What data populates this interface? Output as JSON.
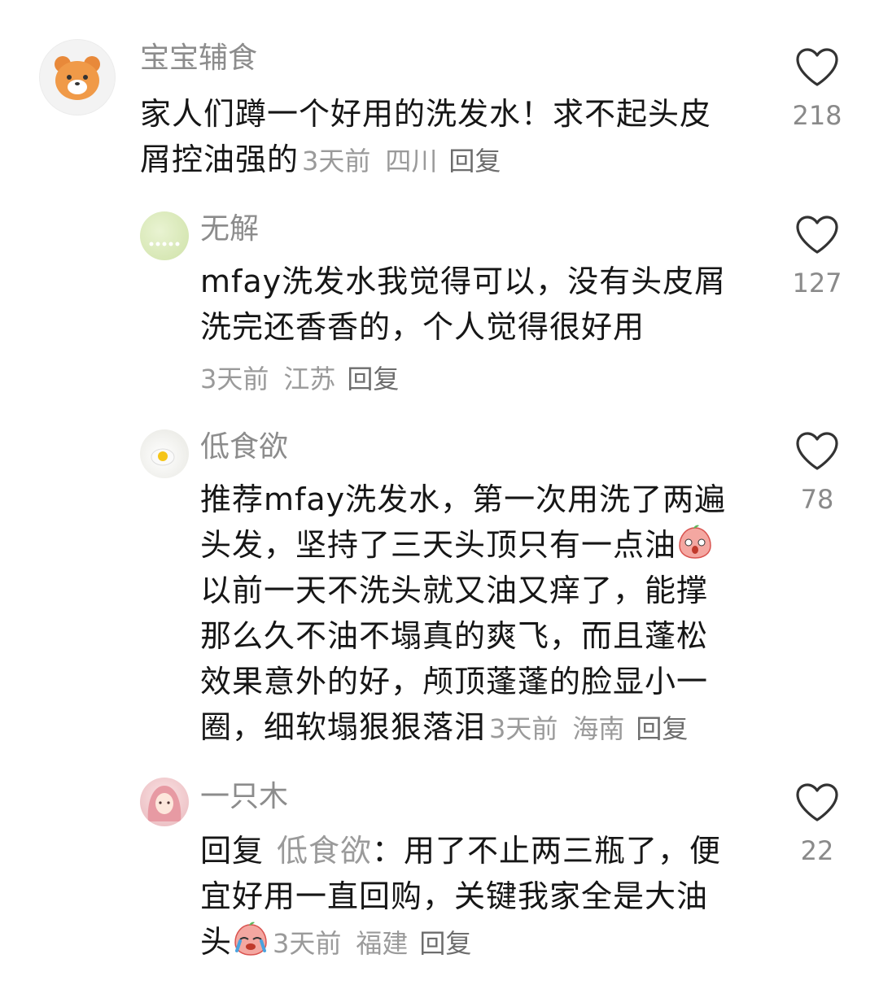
{
  "comments": [
    {
      "username": "宝宝辅食",
      "text_line1": "家人们蹲一个好用的洗发水！求不起头皮",
      "text_line2": "屑控油强的",
      "time": "3天前",
      "location": "四川",
      "reply": "回复",
      "likes": "218",
      "avatar_icon": "bear-avatar-icon"
    },
    {
      "username": "无解",
      "text_line1": "mfay洗发水我觉得可以，没有头皮屑",
      "text_line2": "洗完还香香的，个人觉得很好用",
      "time": "3天前",
      "location": "江苏",
      "reply": "回复",
      "likes": "127"
    },
    {
      "username": "低食欲",
      "text_line1": "推荐mfay洗发水，第一次用洗了两遍",
      "text_line2": "头发，坚持了三天头顶只有一点油",
      "text_line3": "以前一天不洗头就又油又痒了，能撑",
      "text_line4": "那么久不油不塌真的爽飞，而且蓬松",
      "text_line5": "效果意外的好，颅顶蓬蓬的脸显小一",
      "text_line6": "圈，细软塌狠狠落泪",
      "time": "3天前",
      "location": "海南",
      "reply": "回复",
      "likes": "78"
    },
    {
      "username": "一只木",
      "reply_prefix": "回复",
      "reply_to": "低食欲",
      "reply_colon": "：",
      "text_line1": "用了不止两三瓶了，便",
      "text_line2": "宜好用一直回购，关键我家全是大油",
      "text_line3": "头",
      "time": "3天前",
      "location": "福建",
      "reply": "回复",
      "likes": "22"
    }
  ],
  "colors": {
    "username": "#8c8c8c",
    "text": "#161616",
    "meta": "#9a9a9a",
    "heart_stroke": "#333333"
  }
}
